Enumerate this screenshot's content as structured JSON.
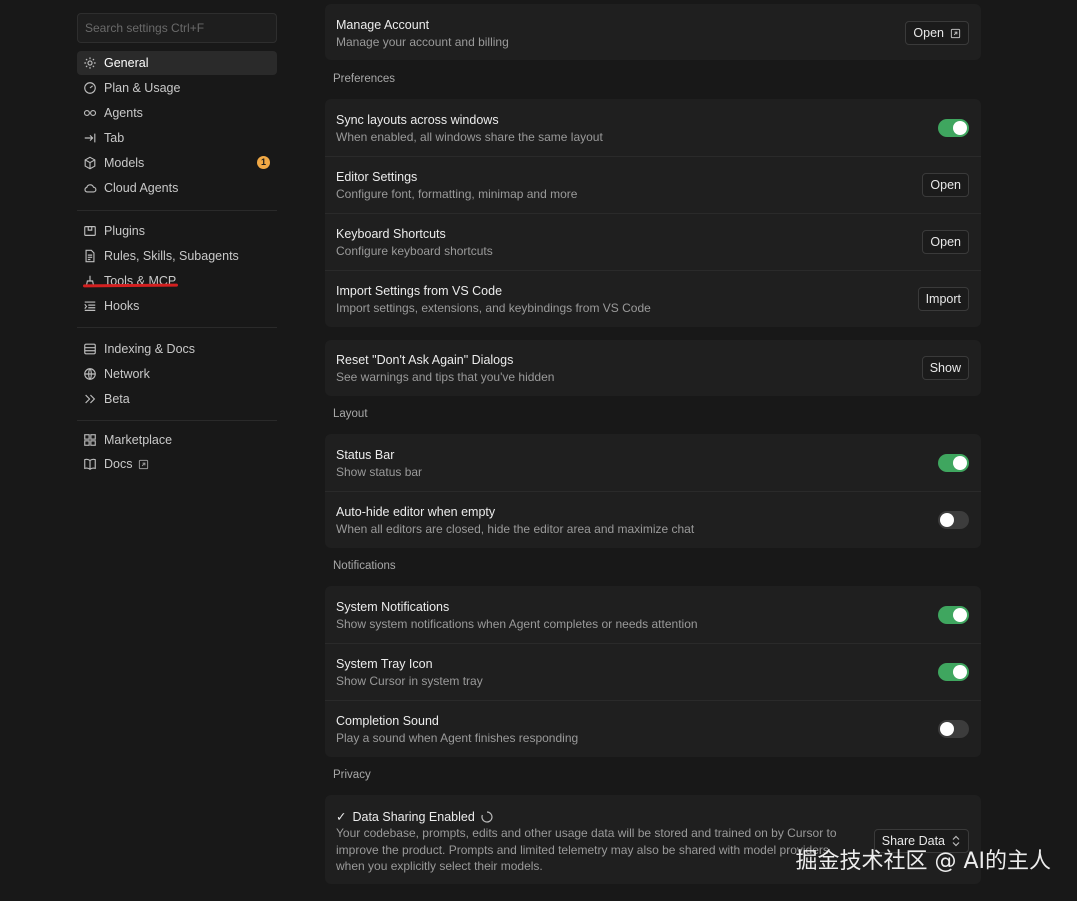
{
  "search": {
    "placeholder": "Search settings Ctrl+F"
  },
  "sidebar": {
    "groups": [
      [
        {
          "label": "General",
          "icon": "gear-icon",
          "active": true
        },
        {
          "label": "Plan & Usage",
          "icon": "gauge-icon"
        },
        {
          "label": "Agents",
          "icon": "infinity-icon"
        },
        {
          "label": "Tab",
          "icon": "arrow-tab-icon"
        },
        {
          "label": "Models",
          "icon": "cube-icon",
          "badge": "1"
        },
        {
          "label": "Cloud Agents",
          "icon": "cloud-icon"
        }
      ],
      [
        {
          "label": "Plugins",
          "icon": "package-icon"
        },
        {
          "label": "Rules, Skills, Subagents",
          "icon": "document-icon"
        },
        {
          "label": "Tools & MCP",
          "icon": "tools-icon"
        },
        {
          "label": "Hooks",
          "icon": "hooks-icon"
        }
      ],
      [
        {
          "label": "Indexing & Docs",
          "icon": "database-icon"
        },
        {
          "label": "Network",
          "icon": "globe-icon"
        },
        {
          "label": "Beta",
          "icon": "chevrons-right-icon"
        }
      ],
      [
        {
          "label": "Marketplace",
          "icon": "grid-icon"
        },
        {
          "label": "Docs",
          "icon": "book-icon",
          "external": true
        }
      ]
    ]
  },
  "account": {
    "title": "Manage Account",
    "desc": "Manage your account and billing",
    "button": "Open"
  },
  "sections": {
    "preferences": "Preferences",
    "layout": "Layout",
    "notifications": "Notifications",
    "privacy": "Privacy"
  },
  "preferences": [
    {
      "title": "Sync layouts across windows",
      "desc": "When enabled, all windows share the same layout",
      "toggle": true
    },
    {
      "title": "Editor Settings",
      "desc": "Configure font, formatting, minimap and more",
      "button": "Open"
    },
    {
      "title": "Keyboard Shortcuts",
      "desc": "Configure keyboard shortcuts",
      "button": "Open"
    },
    {
      "title": "Import Settings from VS Code",
      "desc": "Import settings, extensions, and keybindings from VS Code",
      "button": "Import"
    }
  ],
  "dialogs": {
    "title": "Reset \"Don't Ask Again\" Dialogs",
    "desc": "See warnings and tips that you've hidden",
    "button": "Show"
  },
  "layout": [
    {
      "title": "Status Bar",
      "desc": "Show status bar",
      "toggle": true
    },
    {
      "title": "Auto-hide editor when empty",
      "desc": "When all editors are closed, hide the editor area and maximize chat",
      "toggle": false
    }
  ],
  "notifications": [
    {
      "title": "System Notifications",
      "desc": "Show system notifications when Agent completes or needs attention",
      "toggle": true
    },
    {
      "title": "System Tray Icon",
      "desc": "Show Cursor in system tray",
      "toggle": true
    },
    {
      "title": "Completion Sound",
      "desc": "Play a sound when Agent finishes responding",
      "toggle": false
    }
  ],
  "privacy": {
    "check": "✓",
    "title": "Data Sharing Enabled",
    "desc": "Your codebase, prompts, edits and other usage data will be stored and trained on by Cursor to improve the product. Prompts and limited telemetry may also be shared with model providers when you explicitly select their models.",
    "select": "Share Data"
  },
  "watermark": "掘金技术社区 @ AI的主人",
  "colors": {
    "toggle_on": "#3fa65f",
    "badge": "#f0a845",
    "annotation": "#d32020"
  }
}
